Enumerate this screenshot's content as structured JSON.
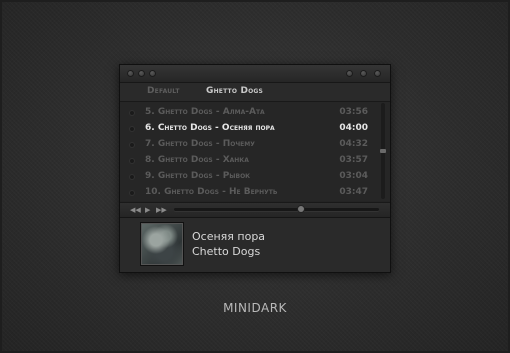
{
  "tabs": [
    {
      "label": "Default"
    },
    {
      "label": "Ghetto Dogs"
    }
  ],
  "playlist": [
    {
      "title": "5. Ghetto Dogs - Алма-Ата",
      "time": "03:56",
      "active": false
    },
    {
      "title": "6. Chetto Dogs - Осеняя пора",
      "time": "04:00",
      "active": true
    },
    {
      "title": "7. Ghetto Dogs - Почему",
      "time": "04:32",
      "active": false
    },
    {
      "title": "8. Ghetto Dogs - Ханка",
      "time": "03:57",
      "active": false
    },
    {
      "title": "9. Ghetto Dogs - Рывок",
      "time": "03:04",
      "active": false
    },
    {
      "title": "10. Ghetto Dogs - Не Вернуть",
      "time": "03:47",
      "active": false
    }
  ],
  "controls": {
    "prev_icon": "◀◀",
    "play_icon": "▶",
    "next_icon": "▶▶",
    "seek_progress": 0.62
  },
  "now_playing": {
    "title": "Осеняя пора",
    "artist": "Chetto Dogs"
  },
  "brand": "MINIDARK"
}
